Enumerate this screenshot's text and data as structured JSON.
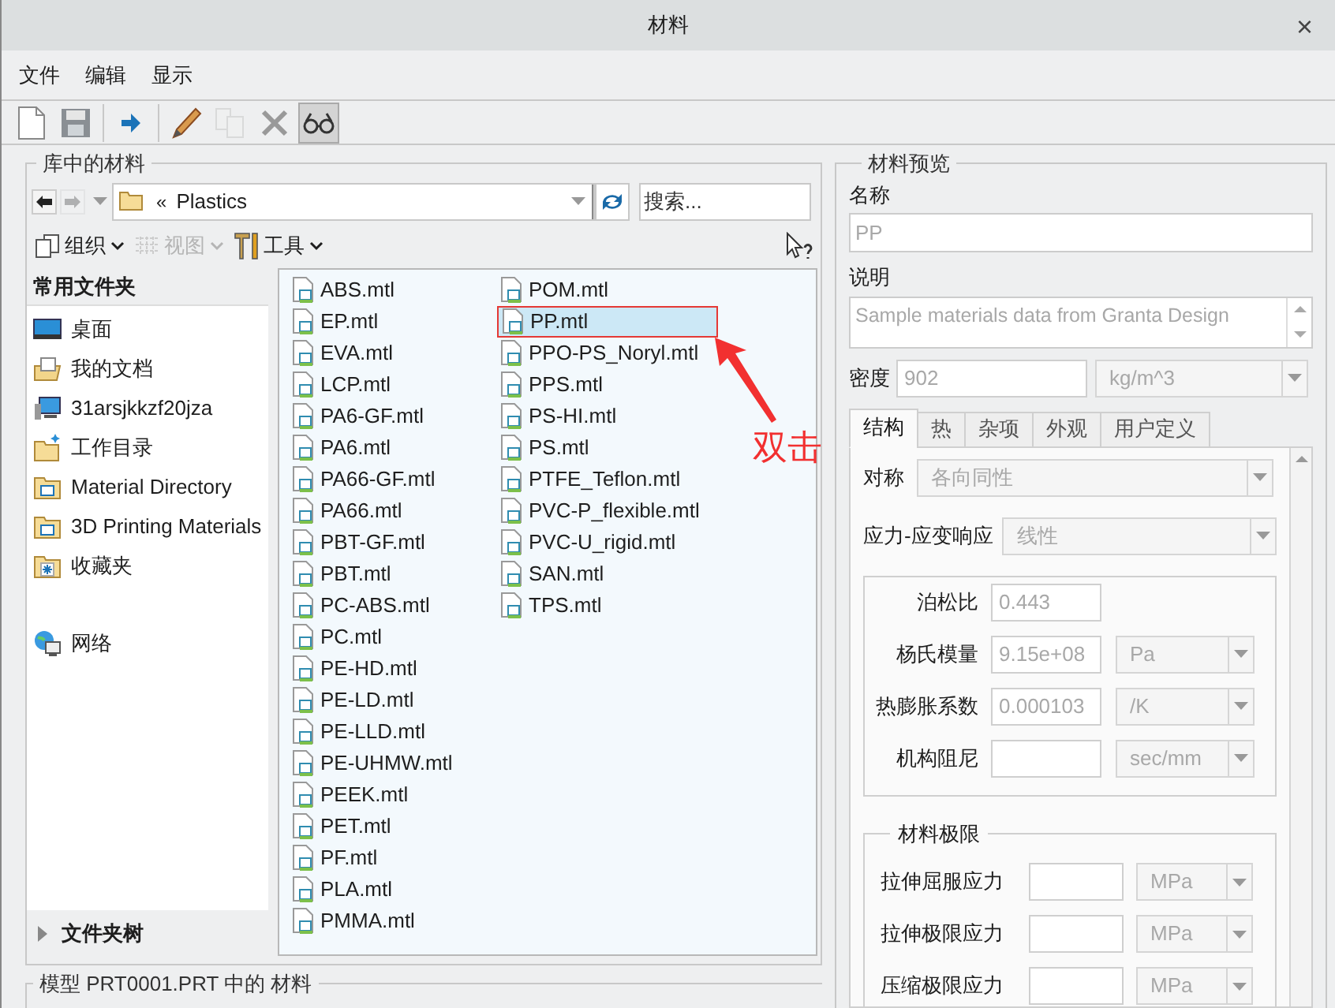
{
  "window": {
    "title": "材料",
    "close": "×"
  },
  "menu": [
    "文件",
    "编辑",
    "显示"
  ],
  "toolbar": [
    {
      "kind": "new",
      "disabled": false,
      "pressed": false
    },
    {
      "kind": "save",
      "disabled": false,
      "pressed": false
    },
    {
      "kind": "sep"
    },
    {
      "kind": "assign",
      "disabled": false,
      "pressed": false
    },
    {
      "kind": "sep"
    },
    {
      "kind": "edit",
      "disabled": false,
      "pressed": false
    },
    {
      "kind": "copy",
      "disabled": true,
      "pressed": false
    },
    {
      "kind": "delete",
      "disabled": false,
      "pressed": false
    },
    {
      "kind": "preview",
      "disabled": false,
      "pressed": true
    }
  ],
  "library": {
    "title": "库中的材料",
    "nav": {
      "back_disabled": false,
      "forward_disabled": true,
      "breadcrumb_marker": "«",
      "path": "Plastics",
      "search_placeholder": "搜索..."
    },
    "commands": [
      {
        "label": "组织",
        "kind": "organize",
        "disabled": false
      },
      {
        "label": "视图",
        "kind": "view",
        "disabled": true
      },
      {
        "label": "工具",
        "kind": "tools",
        "disabled": false
      }
    ],
    "sidebar": {
      "title": "常用文件夹",
      "items": [
        {
          "label": "桌面",
          "kind": "desktop"
        },
        {
          "label": "我的文档",
          "kind": "documents"
        },
        {
          "label": "31arsjkkzf20jza",
          "kind": "computer"
        },
        {
          "label": "工作目录",
          "kind": "workdir"
        },
        {
          "label": "Material Directory",
          "kind": "folder"
        },
        {
          "label": "3D Printing Materials",
          "kind": "folder"
        },
        {
          "label": "收藏夹",
          "kind": "favorites"
        },
        {
          "label": "网络",
          "kind": "network"
        }
      ],
      "tree": {
        "label": "文件夹树",
        "expanded": false
      }
    },
    "files": [
      {
        "name": "ABS.mtl",
        "selected": false
      },
      {
        "name": "EP.mtl",
        "selected": false
      },
      {
        "name": "EVA.mtl",
        "selected": false
      },
      {
        "name": "LCP.mtl",
        "selected": false
      },
      {
        "name": "PA6-GF.mtl",
        "selected": false
      },
      {
        "name": "PA6.mtl",
        "selected": false
      },
      {
        "name": "PA66-GF.mtl",
        "selected": false
      },
      {
        "name": "PA66.mtl",
        "selected": false
      },
      {
        "name": "PBT-GF.mtl",
        "selected": false
      },
      {
        "name": "PBT.mtl",
        "selected": false
      },
      {
        "name": "PC-ABS.mtl",
        "selected": false
      },
      {
        "name": "PC.mtl",
        "selected": false
      },
      {
        "name": "PE-HD.mtl",
        "selected": false
      },
      {
        "name": "PE-LD.mtl",
        "selected": false
      },
      {
        "name": "PE-LLD.mtl",
        "selected": false
      },
      {
        "name": "PE-UHMW.mtl",
        "selected": false
      },
      {
        "name": "PEEK.mtl",
        "selected": false
      },
      {
        "name": "PET.mtl",
        "selected": false
      },
      {
        "name": "PF.mtl",
        "selected": false
      },
      {
        "name": "PLA.mtl",
        "selected": false
      },
      {
        "name": "PMMA.mtl",
        "selected": false
      },
      {
        "name": "POM.mtl",
        "selected": false
      },
      {
        "name": "PP.mtl",
        "selected": true
      },
      {
        "name": "PPO-PS_Noryl.mtl",
        "selected": false
      },
      {
        "name": "PPS.mtl",
        "selected": false
      },
      {
        "name": "PS-HI.mtl",
        "selected": false
      },
      {
        "name": "PS.mtl",
        "selected": false
      },
      {
        "name": "PTFE_Teflon.mtl",
        "selected": false
      },
      {
        "name": "PVC-P_flexible.mtl",
        "selected": false
      },
      {
        "name": "PVC-U_rigid.mtl",
        "selected": false
      },
      {
        "name": "SAN.mtl",
        "selected": false
      },
      {
        "name": "TPS.mtl",
        "selected": false
      }
    ],
    "annotation": {
      "text": "双击"
    }
  },
  "model_group": {
    "title": "模型 PRT0001.PRT 中的 材料"
  },
  "preview": {
    "title": "材料预览",
    "name": {
      "label": "名称",
      "value": "PP"
    },
    "description": {
      "label": "说明",
      "value": "Sample materials data from Granta Design"
    },
    "density": {
      "label": "密度",
      "value": "902",
      "unit": "kg/m^3"
    },
    "tabs": [
      {
        "label": "结构",
        "selected": true
      },
      {
        "label": "热",
        "selected": false
      },
      {
        "label": "杂项",
        "selected": false
      },
      {
        "label": "外观",
        "selected": false
      },
      {
        "label": "用户定义",
        "selected": false
      }
    ],
    "symmetry": {
      "label": "对称",
      "value": "各向同性"
    },
    "response": {
      "label": "应力-应变响应",
      "value": "线性"
    },
    "properties": [
      {
        "label": "泊松比",
        "value": "0.443"
      },
      {
        "label": "杨氏模量",
        "value": "9.15e+08",
        "unit": "Pa"
      },
      {
        "label": "热膨胀系数",
        "value": "0.000103",
        "unit": "/K"
      },
      {
        "label": "机构阻尼",
        "unit": "sec/mm"
      }
    ],
    "limits": {
      "title": "材料极限",
      "rows": [
        {
          "label": "拉伸屈服应力",
          "unit": "MPa"
        },
        {
          "label": "拉伸极限应力",
          "unit": "MPa"
        },
        {
          "label": "压缩极限应力",
          "unit": "MPa"
        }
      ]
    }
  }
}
